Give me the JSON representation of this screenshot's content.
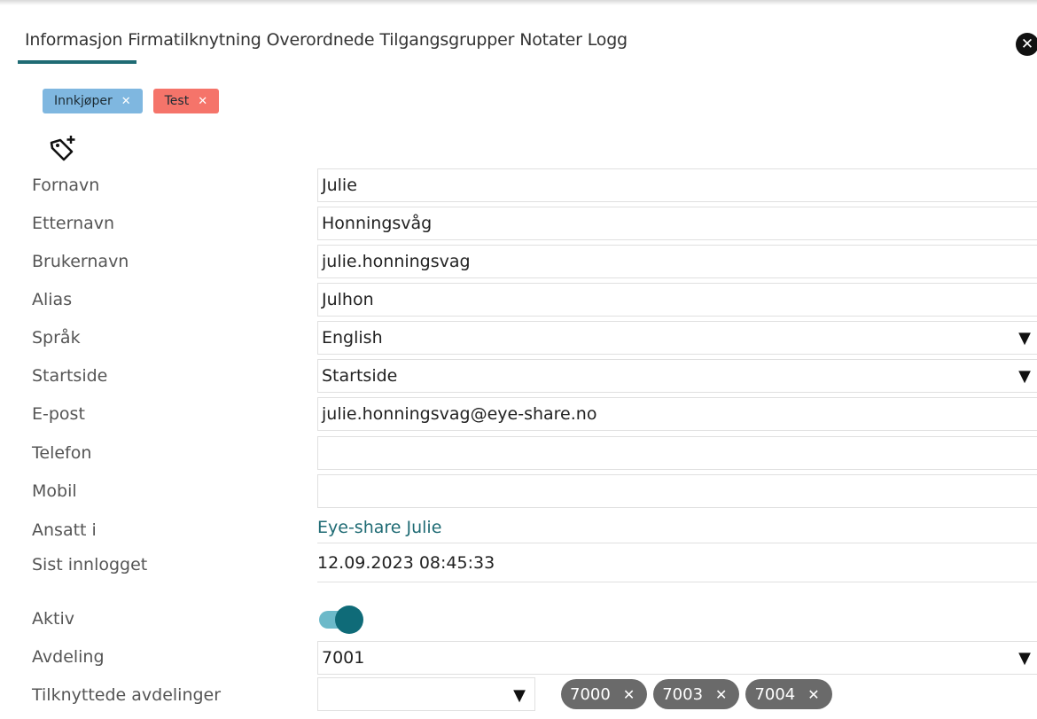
{
  "tabs": [
    {
      "label": "Informasjon",
      "active": true
    },
    {
      "label": "Firmatilknytning",
      "active": false
    },
    {
      "label": "Overordnede",
      "active": false
    },
    {
      "label": "Tilgangsgrupper",
      "active": false
    },
    {
      "label": "Notater",
      "active": false
    },
    {
      "label": "Logg",
      "active": false
    }
  ],
  "close_icon": "close-circle-icon",
  "tags": [
    {
      "label": "Innkjøper",
      "color": "#7fb7e0",
      "remove": "✕"
    },
    {
      "label": "Test",
      "color": "#f5746a",
      "remove": "✕"
    }
  ],
  "add_tag_icon": "tag-plus-icon",
  "form": {
    "fornavn": {
      "label": "Fornavn",
      "value": "Julie"
    },
    "etternavn": {
      "label": "Etternavn",
      "value": "Honningsvåg"
    },
    "brukernavn": {
      "label": "Brukernavn",
      "value": "julie.honningsvag"
    },
    "alias": {
      "label": "Alias",
      "value": "Julhon"
    },
    "sprak": {
      "label": "Språk",
      "value": "English"
    },
    "startside": {
      "label": "Startside",
      "value": "Startside"
    },
    "epost": {
      "label": "E-post",
      "value": "julie.honningsvag@eye-share.no"
    },
    "telefon": {
      "label": "Telefon",
      "value": ""
    },
    "mobil": {
      "label": "Mobil",
      "value": ""
    },
    "ansatt_i": {
      "label": "Ansatt i",
      "value": "Eye-share Julie"
    },
    "sist_innlogget": {
      "label": "Sist innlogget",
      "value": "12.09.2023 08:45:33"
    },
    "aktiv": {
      "label": "Aktiv",
      "on": true
    },
    "avdeling": {
      "label": "Avdeling",
      "value": "7001"
    },
    "tilknyttede": {
      "label": "Tilknyttede avdelinger",
      "value": ""
    }
  },
  "dropdown_arrow": "▼",
  "chips": [
    {
      "label": "7000",
      "remove": "✕"
    },
    {
      "label": "7003",
      "remove": "✕"
    },
    {
      "label": "7004",
      "remove": "✕"
    }
  ],
  "colors": {
    "accent": "#1f6b74",
    "toggle_track": "#6cb9c9",
    "toggle_knob": "#0f6b78",
    "chip": "#6a6a6a"
  }
}
